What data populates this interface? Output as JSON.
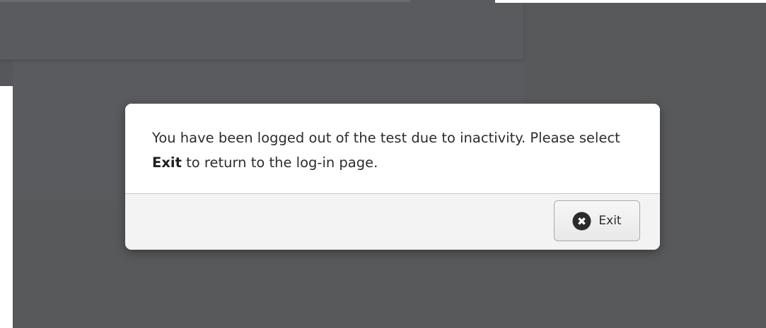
{
  "dialog": {
    "message_part1": "You have been logged out of the test due to inactivity. Please select ",
    "message_bold": "Exit",
    "message_part2": " to return to the log-in page.",
    "exit_button": {
      "label": "Exit",
      "icon": "close-circle-icon"
    }
  },
  "colors": {
    "overlay": "#58595b",
    "dialog_bg": "#ffffff",
    "footer_bg": "#f3f3f3",
    "icon": "#2b2b2b"
  }
}
